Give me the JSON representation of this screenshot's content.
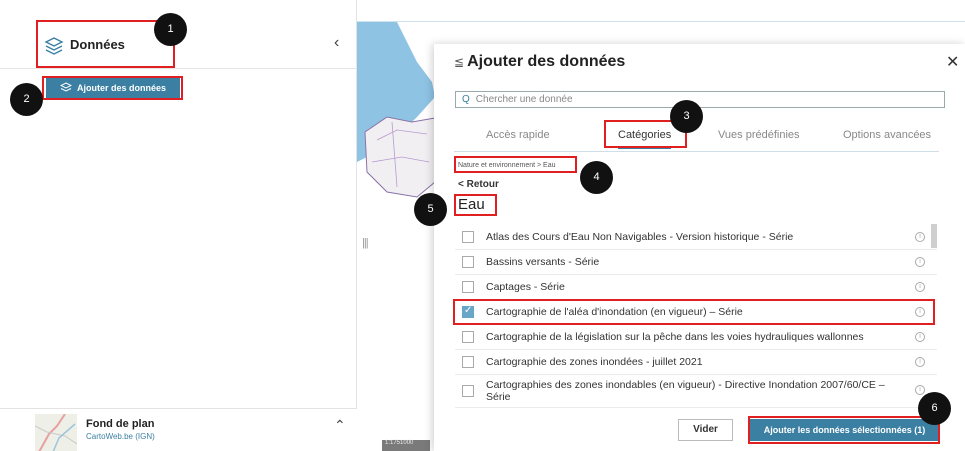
{
  "left_panel": {
    "title": "Données",
    "add_button": "Ajouter des données",
    "fond": {
      "title": "Fond de plan",
      "subtitle": "CartoWeb.be (IGN)"
    }
  },
  "map": {
    "splitter": "|||",
    "scale": "1:1751000"
  },
  "modal": {
    "title": "Ajouter des données",
    "search_placeholder": "Chercher une donnée",
    "tabs": [
      "Accès rapide",
      "Catégories",
      "Vues prédéfinies",
      "Options avancées"
    ],
    "active_tab": "Catégories",
    "breadcrumb": "Nature et environnement > Eau",
    "back": "< Retour",
    "category": "Eau",
    "items": [
      {
        "label": "Atlas des Cours d'Eau Non Navigables - Version historique - Série",
        "checked": false
      },
      {
        "label": "Bassins versants - Série",
        "checked": false
      },
      {
        "label": "Captages - Série",
        "checked": false
      },
      {
        "label": "Cartographie de l'aléa d'inondation (en vigueur) – Série",
        "checked": true
      },
      {
        "label": "Cartographie de la législation sur la pêche dans les voies hydrauliques wallonnes",
        "checked": false
      },
      {
        "label": "Cartographie des zones inondées - juillet 2021",
        "checked": false
      },
      {
        "label": "Cartographies des zones inondables (en vigueur) - Directive Inondation 2007/60/CE – Série",
        "checked": false
      }
    ],
    "clear_button": "Vider",
    "submit_button": "Ajouter les données sélectionnées (1)"
  },
  "annotations": [
    "1",
    "2",
    "3",
    "4",
    "5",
    "6"
  ],
  "colors": {
    "accent": "#3b7fa3",
    "highlight": "#e02020",
    "checkbox": "#6aa6c7"
  }
}
